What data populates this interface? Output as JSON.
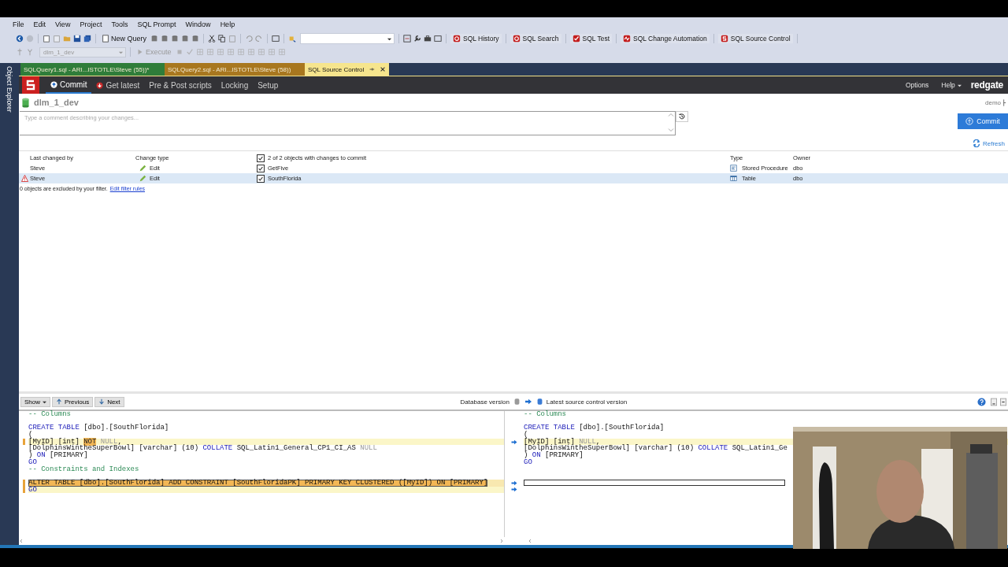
{
  "menu": [
    "File",
    "Edit",
    "View",
    "Project",
    "Tools",
    "SQL Prompt",
    "Window",
    "Help"
  ],
  "toolbar": {
    "new_query": "New Query",
    "database": "dlm_1_dev",
    "execute": "Execute",
    "tools": [
      {
        "label": "SQL History",
        "kind": "history"
      },
      {
        "label": "SQL Search",
        "kind": "search"
      },
      {
        "label": "SQL Test",
        "kind": "test"
      },
      {
        "label": "SQL Change Automation",
        "kind": "automation"
      },
      {
        "label": "SQL Source Control",
        "kind": "source"
      }
    ]
  },
  "document_tabs": [
    {
      "label": "SQLQuery1.sql - ARI...ISTOTLE\\Steve (55))*",
      "color": "#2f7d3a",
      "selected": false
    },
    {
      "label": "SQLQuery2.sql - ARI...ISTOTLE\\Steve (58))",
      "color": "#a8771f",
      "selected": false
    },
    {
      "label": "SQL Source Control",
      "color": "#f6e58d",
      "selected": true
    }
  ],
  "side_panel": "Object Explorer",
  "nav": {
    "tabs": [
      {
        "label": "Commit",
        "kind": "commit",
        "selected": true
      },
      {
        "label": "Get latest",
        "kind": "get",
        "selected": false
      },
      {
        "label": "Pre & Post scripts",
        "kind": "plain",
        "selected": false
      },
      {
        "label": "Locking",
        "kind": "plain",
        "selected": false
      },
      {
        "label": "Setup",
        "kind": "plain",
        "selected": false
      }
    ],
    "options": "Options",
    "help": "Help",
    "logo": "redgate"
  },
  "commit": {
    "database": "dlm_1_dev",
    "branch": "demo",
    "comment_placeholder": "Type a comment describing your changes...",
    "commit_button": "Commit",
    "refresh": "Refresh"
  },
  "grid": {
    "columns": [
      "Last changed by",
      "Change type",
      "2 of 2 objects with changes to commit",
      "Type",
      "Owner"
    ],
    "all_checked": true,
    "rows": [
      {
        "warning": false,
        "changed_by": "Steve",
        "change_type": "Edit",
        "checked": true,
        "name": "GetFive",
        "type": "Stored Procedure",
        "kind": "procedure",
        "owner": "dbo",
        "selected": false
      },
      {
        "warning": true,
        "changed_by": "Steve",
        "change_type": "Edit",
        "checked": true,
        "name": "SouthFlorida",
        "type": "Table",
        "kind": "table",
        "owner": "dbo",
        "selected": true
      }
    ]
  },
  "filter": {
    "text": "0 objects are excluded by your filter.",
    "link": "Edit filter rules"
  },
  "diff": {
    "show": "Show",
    "previous": "Previous",
    "next": "Next",
    "left_title": "Database version",
    "right_title": "Latest source control version",
    "left_lines": [
      {
        "kind": "same",
        "tokens": [
          {
            "text": "-- Columns",
            "kind": "comment"
          }
        ]
      },
      {
        "kind": "same"
      },
      {
        "kind": "same",
        "tokens": [
          {
            "text": "CREATE TABLE",
            "kind": "keyword"
          },
          {
            "text": " [dbo].[SouthFlorida]",
            "kind": "plain"
          }
        ]
      },
      {
        "kind": "same",
        "tokens": [
          {
            "text": "(",
            "kind": "plain"
          }
        ]
      },
      {
        "kind": "modified",
        "tokens": [
          {
            "text": "[MyID] [int] ",
            "kind": "plain"
          },
          {
            "text": "NOT",
            "kind": "diff"
          },
          {
            "text": " NULL",
            "kind": "null"
          },
          {
            "text": ",",
            "kind": "plain"
          }
        ]
      },
      {
        "kind": "same",
        "tokens": [
          {
            "text": "[DolphinsWintheSuperBowl] [varchar] (10) ",
            "kind": "plain"
          },
          {
            "text": "COLLATE",
            "kind": "keyword"
          },
          {
            "text": " SQL_Latin1_General_CP1_CI_AS ",
            "kind": "plain"
          },
          {
            "text": "NULL",
            "kind": "null"
          }
        ]
      },
      {
        "kind": "same",
        "tokens": [
          {
            "text": ") ",
            "kind": "plain"
          },
          {
            "text": "ON",
            "kind": "keyword"
          },
          {
            "text": " [PRIMARY]",
            "kind": "plain"
          }
        ]
      },
      {
        "kind": "same",
        "tokens": [
          {
            "text": "GO",
            "kind": "keyword"
          }
        ]
      },
      {
        "kind": "same",
        "tokens": [
          {
            "text": "-- Constraints and Indexes",
            "kind": "comment"
          }
        ]
      },
      {
        "kind": "same"
      },
      {
        "kind": "added",
        "tokens": [
          {
            "text": "ALTER TABLE [dbo].[SouthFlorida] ADD CONSTRAINT [SouthFloridaPK] PRIMARY KEY CLUSTERED ([MyID]) ON [PRIMARY]",
            "kind": "plain"
          }
        ]
      },
      {
        "kind": "modified",
        "tokens": [
          {
            "text": "GO",
            "kind": "keyword"
          }
        ]
      }
    ],
    "right_lines": [
      {
        "kind": "same",
        "tokens": [
          {
            "text": "-- Columns",
            "kind": "comment"
          }
        ]
      },
      {
        "kind": "same"
      },
      {
        "kind": "same",
        "tokens": [
          {
            "text": "CREATE TABLE",
            "kind": "keyword"
          },
          {
            "text": " [dbo].[SouthFlorida]",
            "kind": "plain"
          }
        ]
      },
      {
        "kind": "same",
        "tokens": [
          {
            "text": "(",
            "kind": "plain"
          }
        ]
      },
      {
        "kind": "modified",
        "tokens": [
          {
            "text": "[MyID] [int] ",
            "kind": "plain"
          },
          {
            "text": "NULL",
            "kind": "null"
          },
          {
            "text": ",",
            "kind": "plain"
          }
        ]
      },
      {
        "kind": "same",
        "tokens": [
          {
            "text": "[DolphinsWintheSuperBowl] [varchar] (10) ",
            "kind": "plain"
          },
          {
            "text": "COLLATE",
            "kind": "keyword"
          },
          {
            "text": " SQL_Latin1_Ge",
            "kind": "plain"
          }
        ]
      },
      {
        "kind": "same",
        "tokens": [
          {
            "text": ") ",
            "kind": "plain"
          },
          {
            "text": "ON",
            "kind": "keyword"
          },
          {
            "text": " [PRIMARY]",
            "kind": "plain"
          }
        ]
      },
      {
        "kind": "same",
        "tokens": [
          {
            "text": "GO",
            "kind": "keyword"
          }
        ]
      },
      {
        "kind": "same"
      },
      {
        "kind": "same"
      },
      {
        "kind": "missing"
      },
      {
        "kind": "gap"
      }
    ]
  }
}
